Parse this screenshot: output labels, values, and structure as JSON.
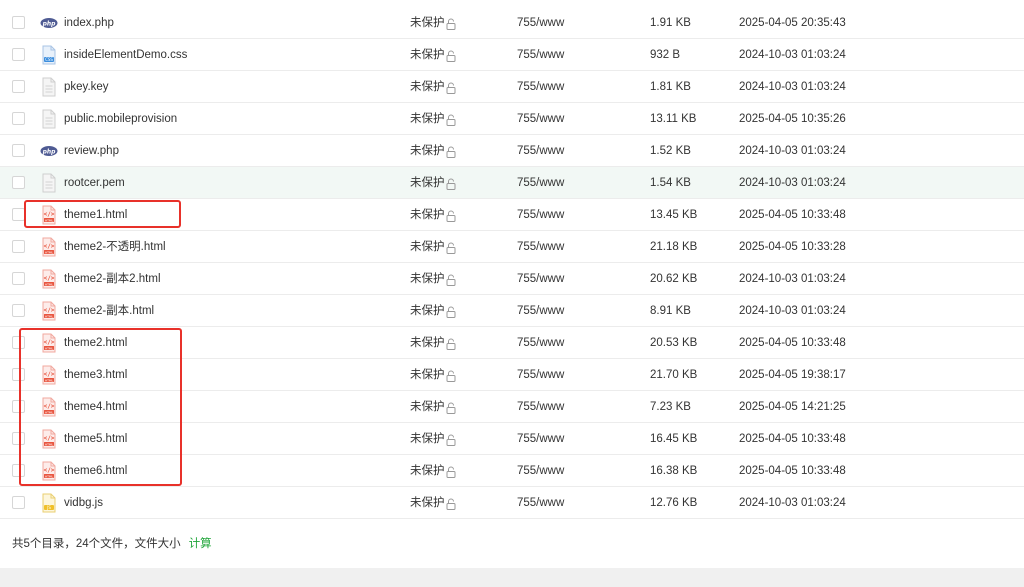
{
  "files": [
    {
      "name": "index.php",
      "type": "php",
      "protect": "未保护",
      "perm": "755/www",
      "size": "1.91 KB",
      "mtime": "2025-04-05 20:35:43"
    },
    {
      "name": "insideElementDemo.css",
      "type": "css",
      "protect": "未保护",
      "perm": "755/www",
      "size": "932 B",
      "mtime": "2024-10-03 01:03:24"
    },
    {
      "name": "pkey.key",
      "type": "file",
      "protect": "未保护",
      "perm": "755/www",
      "size": "1.81 KB",
      "mtime": "2024-10-03 01:03:24"
    },
    {
      "name": "public.mobileprovision",
      "type": "file",
      "protect": "未保护",
      "perm": "755/www",
      "size": "13.11 KB",
      "mtime": "2025-04-05 10:35:26"
    },
    {
      "name": "review.php",
      "type": "php",
      "protect": "未保护",
      "perm": "755/www",
      "size": "1.52 KB",
      "mtime": "2024-10-03 01:03:24"
    },
    {
      "name": "rootcer.pem",
      "type": "file",
      "protect": "未保护",
      "perm": "755/www",
      "size": "1.54 KB",
      "mtime": "2024-10-03 01:03:24",
      "highlight": true
    },
    {
      "name": "theme1.html",
      "type": "html",
      "protect": "未保护",
      "perm": "755/www",
      "size": "13.45 KB",
      "mtime": "2025-04-05 10:33:48"
    },
    {
      "name": "theme2-不透明.html",
      "type": "html",
      "protect": "未保护",
      "perm": "755/www",
      "size": "21.18 KB",
      "mtime": "2025-04-05 10:33:28"
    },
    {
      "name": "theme2-副本2.html",
      "type": "html",
      "protect": "未保护",
      "perm": "755/www",
      "size": "20.62 KB",
      "mtime": "2024-10-03 01:03:24"
    },
    {
      "name": "theme2-副本.html",
      "type": "html",
      "protect": "未保护",
      "perm": "755/www",
      "size": "8.91 KB",
      "mtime": "2024-10-03 01:03:24"
    },
    {
      "name": "theme2.html",
      "type": "html",
      "protect": "未保护",
      "perm": "755/www",
      "size": "20.53 KB",
      "mtime": "2025-04-05 10:33:48"
    },
    {
      "name": "theme3.html",
      "type": "html",
      "protect": "未保护",
      "perm": "755/www",
      "size": "21.70 KB",
      "mtime": "2025-04-05 19:38:17"
    },
    {
      "name": "theme4.html",
      "type": "html",
      "protect": "未保护",
      "perm": "755/www",
      "size": "7.23 KB",
      "mtime": "2025-04-05 14:21:25"
    },
    {
      "name": "theme5.html",
      "type": "html",
      "protect": "未保护",
      "perm": "755/www",
      "size": "16.45 KB",
      "mtime": "2025-04-05 10:33:48"
    },
    {
      "name": "theme6.html",
      "type": "html",
      "protect": "未保护",
      "perm": "755/www",
      "size": "16.38 KB",
      "mtime": "2025-04-05 10:33:48"
    },
    {
      "name": "vidbg.js",
      "type": "js",
      "protect": "未保护",
      "perm": "755/www",
      "size": "12.76 KB",
      "mtime": "2024-10-03 01:03:24"
    }
  ],
  "footer": {
    "summary": "共5个目录，24个文件，文件大小",
    "calc_label": "计算"
  },
  "colors": {
    "accent": "#20a53a",
    "annotation": "#e8312a",
    "row_highlight": "#f2f8f5"
  },
  "annotations": [
    {
      "label": "",
      "covers_rows": [
        6
      ]
    },
    {
      "label": "",
      "covers_rows": [
        10,
        11,
        12,
        13,
        14
      ]
    }
  ]
}
